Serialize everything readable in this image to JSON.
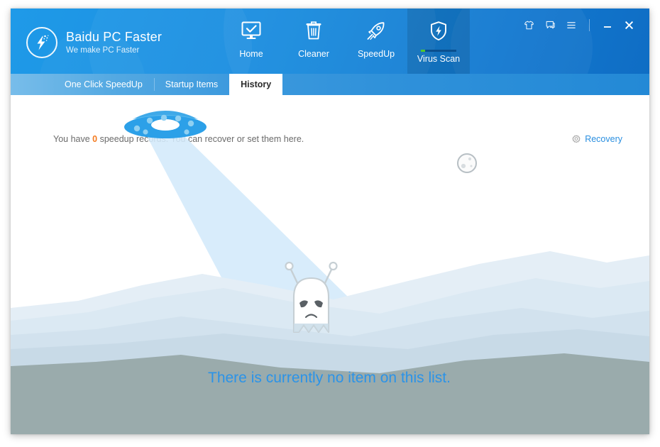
{
  "window": {
    "title": "Baidu PC Faster",
    "tools": [
      {
        "name": "skin-icon",
        "label": "Skin"
      },
      {
        "name": "feedback-icon",
        "label": "Feedback"
      },
      {
        "name": "menu-icon",
        "label": "Menu"
      }
    ],
    "controls": [
      {
        "name": "minimize-button",
        "label": "Minimize"
      },
      {
        "name": "close-button",
        "label": "Close"
      }
    ]
  },
  "brand": {
    "title": "Baidu PC Faster",
    "slogan": "We make PC Faster",
    "logo_icon": "lightning-bolt-icon"
  },
  "nav": {
    "items": [
      {
        "label": "Home",
        "icon": "monitor-check-icon",
        "active": false,
        "progress": null
      },
      {
        "label": "Cleaner",
        "icon": "trash-can-icon",
        "active": false,
        "progress": null
      },
      {
        "label": "SpeedUp",
        "icon": "rocket-icon",
        "active": false,
        "progress": null
      },
      {
        "label": "Virus Scan",
        "icon": "shield-bolt-icon",
        "active": true,
        "progress": 12
      }
    ]
  },
  "subtabs": {
    "items": [
      {
        "label": "One Click SpeedUp",
        "active": false
      },
      {
        "label": "Startup Items",
        "active": false
      },
      {
        "label": "History",
        "active": true
      }
    ]
  },
  "content": {
    "info_prefix": "You have ",
    "info_count": "0",
    "info_suffix": " speedup records. You can recover or set them here.",
    "recovery_label": "Recovery",
    "recovery_icon": "gear-icon",
    "empty_message": "There is currently no item on this list."
  },
  "colors": {
    "header_blue": "#1b8ee0",
    "accent_blue": "#2b93e8",
    "count_orange": "#f47b20",
    "link_blue": "#2a8fe0",
    "active_tab_bg": "#ffffff",
    "progress_green": "#4fc72c",
    "ground_gray": "#9aabac",
    "beam_blue": "#cfe8f9"
  }
}
